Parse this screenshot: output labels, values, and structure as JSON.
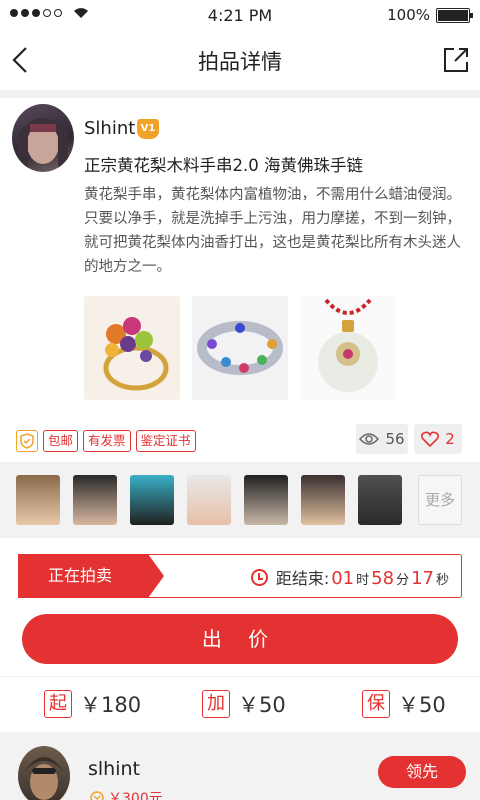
{
  "status_bar": {
    "time": "4:21 PM",
    "battery": "100%"
  },
  "nav": {
    "title": "拍品详情"
  },
  "seller": {
    "name": "Slhint",
    "level_badge": "V1"
  },
  "item": {
    "title": "正宗黄花梨木料手串2.0 海黄佛珠手链",
    "description": "黄花梨手串，黄花梨体内富植物油，不需用什么蜡油侵润。只要以净手，就是洗掉手上污浊，用力摩搓，不到一刻钟，就可把黄花梨体内油香打出，这也是黄花梨比所有木头迷人的地方之一。",
    "images": [
      "ring-image",
      "bracelet-image",
      "jade-pendant-image"
    ]
  },
  "tags": [
    "包邮",
    "有发票",
    "鉴定证书"
  ],
  "stats": {
    "views": "56",
    "likes": "2"
  },
  "viewers": {
    "more_label": "更多"
  },
  "auction": {
    "status": "正在拍卖",
    "countdown_label": "距结束:",
    "hours": "01",
    "hours_unit": "时",
    "minutes": "58",
    "minutes_unit": "分",
    "seconds": "17",
    "seconds_unit": "秒"
  },
  "bid_button": "出 价",
  "prices": {
    "start_tag": "起",
    "start_value": "￥180",
    "increment_tag": "加",
    "increment_value": "￥50",
    "deposit_tag": "保",
    "deposit_value": "￥50"
  },
  "bid_record": {
    "name": "slhint",
    "price": "￥300元",
    "badge": "领先"
  },
  "colors": {
    "accent": "#e43232",
    "gold": "#f3a229",
    "band": "#f2f2f2"
  }
}
